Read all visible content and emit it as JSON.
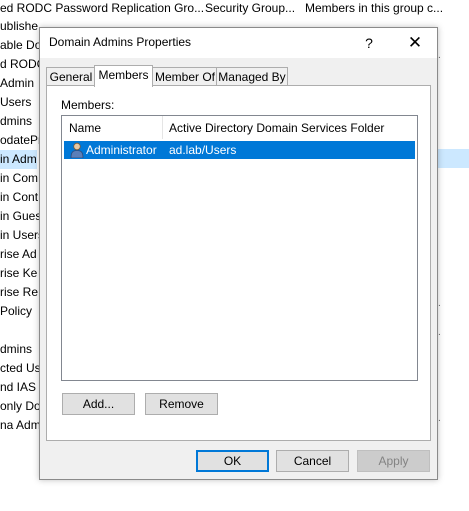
{
  "background": {
    "columns": [
      "ed RODC Password Replication Gro...",
      "Security Group...",
      "Members in this group c..."
    ],
    "rows": [
      "ublishe",
      "able Do",
      "d RODC",
      "Admin",
      "Users",
      "dmins",
      "odatePr",
      "in Adm",
      "in Com",
      "in Cont",
      "in Gues",
      "in Users",
      "rise Ad",
      "rise Ke",
      "rise Re",
      "Policy",
      "",
      "dmins",
      "cted Use",
      "nd IAS S",
      "only Do",
      "na Adm"
    ],
    "right_dots": [
      "."
    ]
  },
  "dialog": {
    "title": "Domain Admins Properties",
    "help_label": "?",
    "close_label": "✕",
    "tabs": [
      {
        "label": "General"
      },
      {
        "label": "Members"
      },
      {
        "label": "Member Of"
      },
      {
        "label": "Managed By"
      }
    ],
    "members_label": "Members:",
    "list": {
      "columns": [
        "Name",
        "Active Directory Domain Services Folder"
      ],
      "rows": [
        {
          "name": "Administrator",
          "folder": "ad.lab/Users",
          "icon": "user-icon"
        }
      ]
    },
    "add_label": "Add...",
    "remove_label": "Remove",
    "ok_label": "OK",
    "cancel_label": "Cancel",
    "apply_label": "Apply"
  },
  "colors": {
    "selection": "#0078d7",
    "bg_selection": "#cce8ff",
    "dialog_bg": "#f0f0f0"
  }
}
